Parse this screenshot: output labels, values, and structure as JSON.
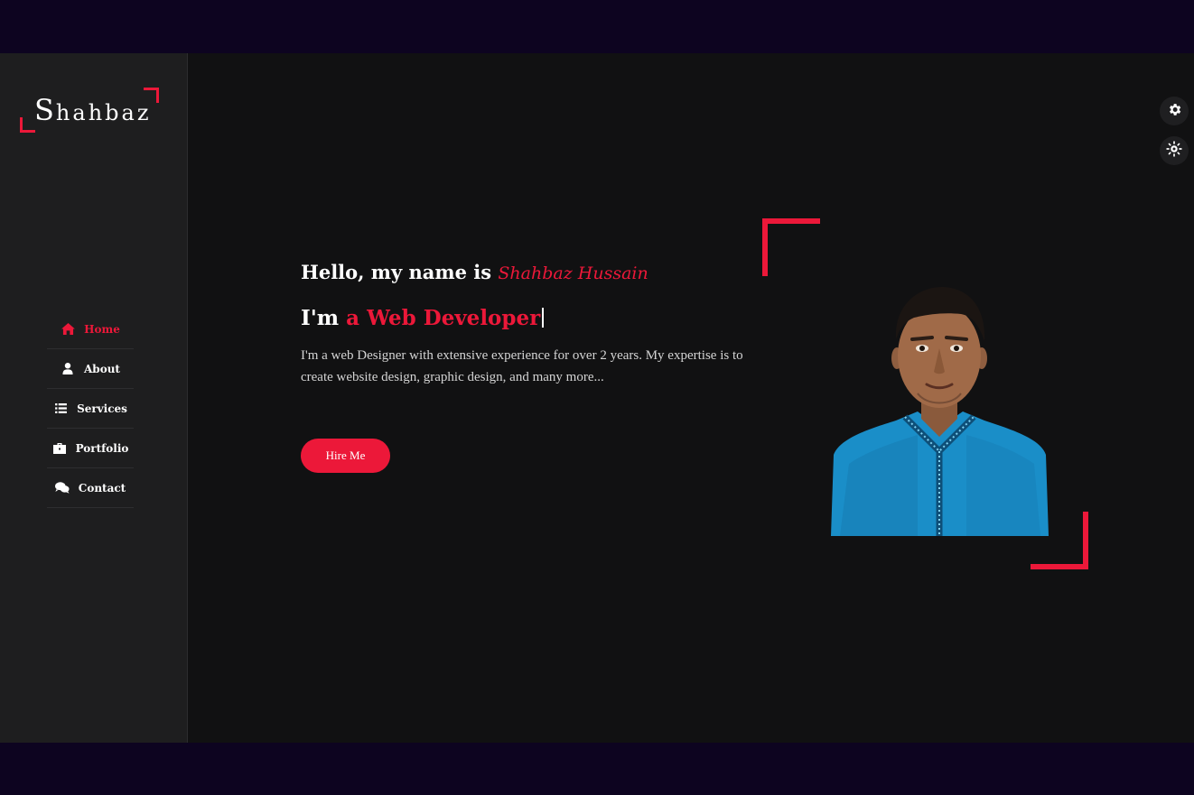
{
  "logo": {
    "initial": "S",
    "rest": "hahbaz"
  },
  "nav": {
    "items": [
      {
        "label": "Home",
        "icon": "home-icon",
        "active": true
      },
      {
        "label": "About",
        "icon": "user-icon",
        "active": false
      },
      {
        "label": "Services",
        "icon": "list-icon",
        "active": false
      },
      {
        "label": "Portfolio",
        "icon": "briefcase-icon",
        "active": false
      },
      {
        "label": "Contact",
        "icon": "comments-icon",
        "active": false
      }
    ]
  },
  "hero": {
    "greeting_prefix": "Hello, my name is",
    "name": "Shahbaz Hussain",
    "role_prefix": "I'm",
    "role_accent": "a Web Developer",
    "bio": "I'm a web Designer with extensive experience for over 2 years. My expertise is to create website design, graphic design, and many more...",
    "cta": "Hire Me"
  },
  "colors": {
    "accent": "#ec1839",
    "sidebar_bg": "#1e1e1f",
    "main_bg": "#111112",
    "page_bg": "#0d0420"
  },
  "icons": {
    "settings_top": "gear-icon",
    "settings_bottom": "sun-gear-icon"
  }
}
